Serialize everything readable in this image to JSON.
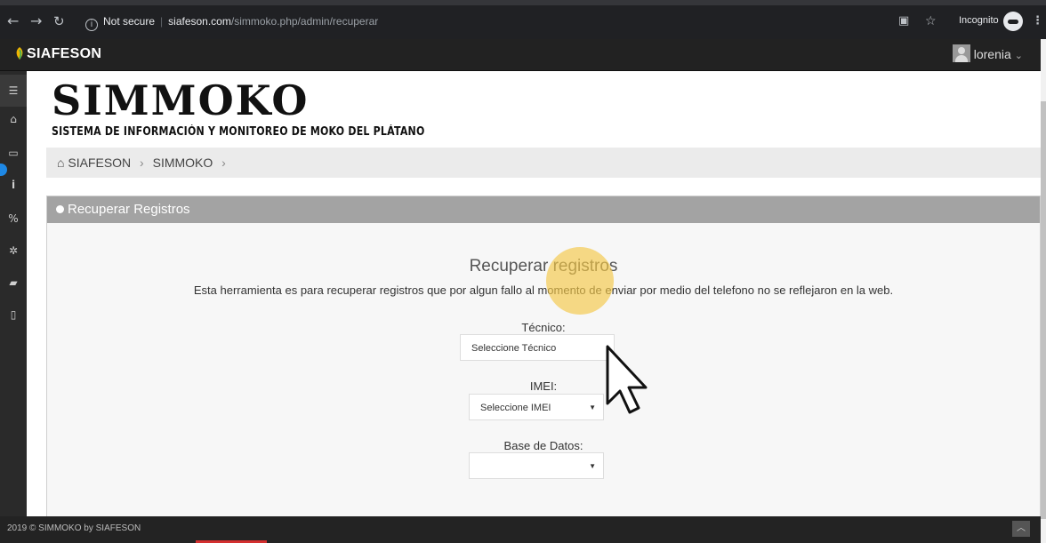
{
  "browser": {
    "security_label": "Not secure",
    "url_domain": "siafeson.com",
    "url_path": "/simmoko.php/admin/recuperar",
    "incognito_label": "Incognito"
  },
  "header": {
    "brand": "SIAFESON",
    "user_name": "lorenia"
  },
  "logo": {
    "title": "SIMMOKO",
    "subtitle": "SISTEMA DE INFORMACIÓN Y MONITOREO DE MOKO DEL PLÁTANO"
  },
  "breadcrumb": {
    "items": [
      "SIAFESON",
      "SIMMOKO"
    ],
    "separator": "›"
  },
  "panel": {
    "heading": "Recuperar Registros",
    "title": "Recuperar registros",
    "description": "Esta herramienta es para recuperar registros que por algun fallo al momento de enviar por medio del telefono no se reflejaron en la web.",
    "tecnico_label": "Técnico:",
    "tecnico_value": "Seleccione Técnico",
    "imei_label": "IMEI:",
    "imei_value": "Seleccione IMEI",
    "base_label": "Base de Datos:",
    "base_value": ""
  },
  "footer": {
    "text": "2019 © SIMMOKO by SIAFESON"
  },
  "colors": {
    "panel_header": "#a3a3a3",
    "chrome_bg": "#202124",
    "app_header": "#222222",
    "highlight": "#f5c846"
  }
}
